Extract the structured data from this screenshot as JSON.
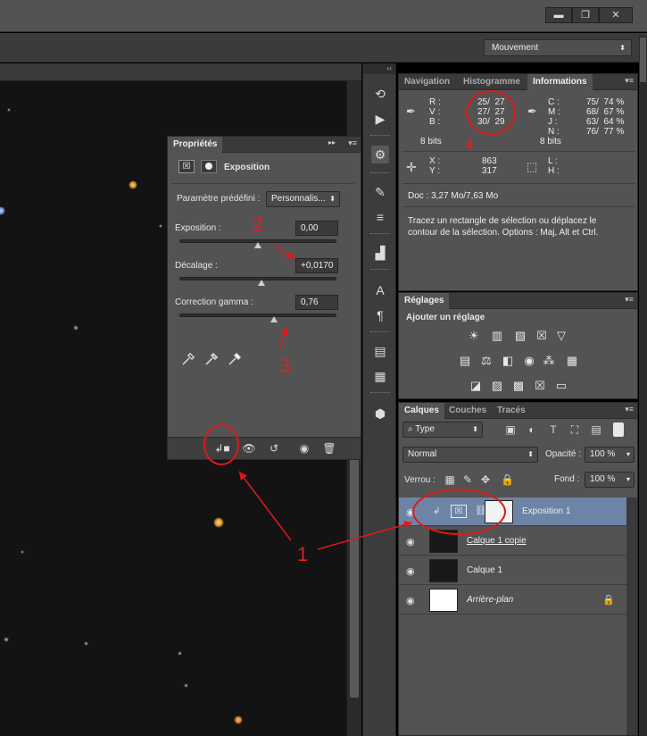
{
  "window": {
    "minimize_label": "▬",
    "restore_label": "❐",
    "close_label": "✕"
  },
  "options_bar": {
    "workspace": "Mouvement"
  },
  "dock_header": "‹‹",
  "properties": {
    "tab": "Propriétés",
    "title": "Exposition",
    "preset_label": "Paramètre prédéfini :",
    "preset_value": "Personnalis...",
    "exposure_label": "Exposition :",
    "exposure_value": "0,00",
    "exposure_level": 0.5,
    "offset_label": "Décalage :",
    "offset_value": "+0,0170",
    "offset_level": 0.52,
    "gamma_label": "Correction gamma :",
    "gamma_value": "0,76",
    "gamma_level": 0.6
  },
  "info": {
    "tabs": [
      "Navigation",
      "Histogramme",
      "Informations"
    ],
    "rgb_labels": "R :\nV :\nB :",
    "rgb_values": "25/  27\n27/  27\n30/  29",
    "bits_left": "8 bits",
    "cmyk_labels": "C :\nM :\nJ :\nN :",
    "cmyk_values": "75/  74 %\n68/  67 %\n63/  64 %\n76/  77 %",
    "bits_right": "8 bits",
    "xy_labels": "X :\nY :",
    "xy_values": "863\n317",
    "lh_labels": "L :\nH :",
    "doc": "Doc : 3,27 Mo/7,63 Mo",
    "hint": "Tracez un rectangle de sélection ou déplacez le contour de la sélection. Options : Maj, Alt et Ctrl."
  },
  "adjustments": {
    "tab": "Réglages",
    "title": "Ajouter un réglage"
  },
  "layers": {
    "tabs": [
      "Calques",
      "Couches",
      "Tracés"
    ],
    "filter": "Type",
    "blend_mode": "Normal",
    "opacity_label": "Opacité :",
    "opacity_value": "100 %",
    "lock_label": "Verrou :",
    "fill_label": "Fond :",
    "fill_value": "100 %",
    "rows": [
      {
        "name": "Exposition 1"
      },
      {
        "name": "Calque 1 copie"
      },
      {
        "name": "Calque 1"
      },
      {
        "name": "Arrière-plan"
      }
    ]
  },
  "annotations": [
    "1",
    "2",
    "3",
    "4"
  ],
  "colors": {
    "annotation": "#e01818",
    "selected_layer": "#6d84a6",
    "panel": "#535353"
  }
}
